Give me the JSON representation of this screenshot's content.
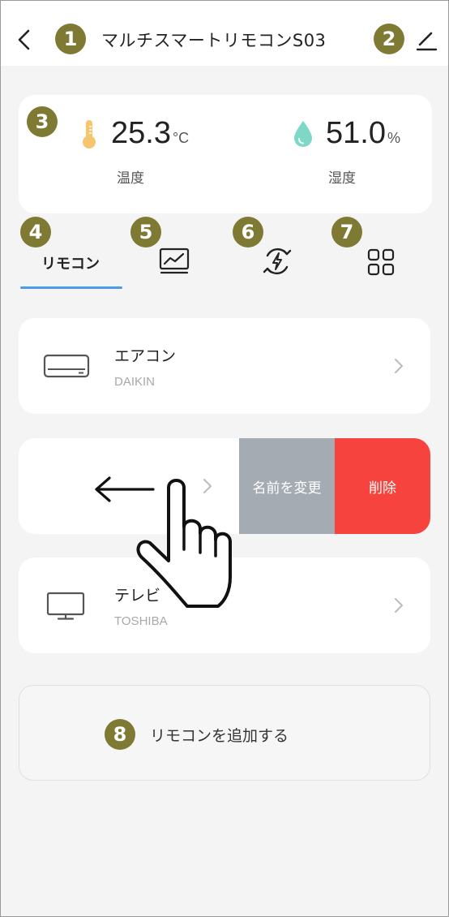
{
  "header": {
    "title": "マルチスマートリモコンS03"
  },
  "badges": [
    "1",
    "2",
    "3",
    "4",
    "5",
    "6",
    "7",
    "8"
  ],
  "environment": {
    "temperature": {
      "value": "25.3",
      "unit": "°C",
      "label": "温度"
    },
    "humidity": {
      "value": "51.0",
      "unit": "%",
      "label": "湿度"
    }
  },
  "tabs": {
    "remote_label": "リモコン",
    "items": [
      "remote",
      "chart-icon",
      "energy-icon",
      "grid-icon"
    ]
  },
  "devices": [
    {
      "name": "エアコン",
      "brand": "DAIKIN",
      "icon": "air-conditioner-icon"
    },
    {
      "name": "",
      "brand": "",
      "icon": ""
    },
    {
      "name": "テレビ",
      "brand": "TOSHIBA",
      "icon": "tv-icon"
    }
  ],
  "swipe_actions": {
    "rename": "名前を変更",
    "delete": "削除"
  },
  "add_remote": "リモコンを追加する",
  "colors": {
    "badge": "#7f7a33",
    "accent": "#4c9be8",
    "delete": "#f6433d",
    "rename": "#a4abb3",
    "background": "#f4f4f5"
  }
}
